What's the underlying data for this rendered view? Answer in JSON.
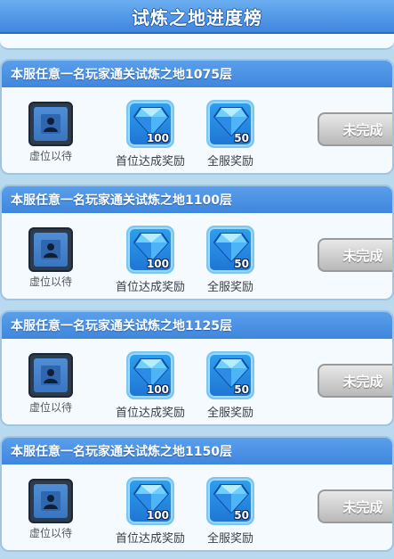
{
  "title": "试炼之地进度榜",
  "colors": {
    "header_blue": "#3f86de",
    "crystal": "#2ea0ee",
    "button_gray": "#b9b9b9"
  },
  "rows": [
    {
      "header": "本服任意一名玩家通关试炼之地1075层",
      "avatar_label": "虚位以待",
      "first_reward": {
        "icon": "diamond-icon",
        "count": "100",
        "label": "首位达成奖励"
      },
      "server_reward": {
        "icon": "diamond-icon",
        "count": "50",
        "label": "全服奖励"
      },
      "status": "未完成"
    },
    {
      "header": "本服任意一名玩家通关试炼之地1100层",
      "avatar_label": "虚位以待",
      "first_reward": {
        "icon": "diamond-icon",
        "count": "100",
        "label": "首位达成奖励"
      },
      "server_reward": {
        "icon": "diamond-icon",
        "count": "50",
        "label": "全服奖励"
      },
      "status": "未完成"
    },
    {
      "header": "本服任意一名玩家通关试炼之地1125层",
      "avatar_label": "虚位以待",
      "first_reward": {
        "icon": "diamond-icon",
        "count": "100",
        "label": "首位达成奖励"
      },
      "server_reward": {
        "icon": "diamond-icon",
        "count": "50",
        "label": "全服奖励"
      },
      "status": "未完成"
    },
    {
      "header": "本服任意一名玩家通关试炼之地1150层",
      "avatar_label": "虚位以待",
      "first_reward": {
        "icon": "diamond-icon",
        "count": "100",
        "label": "首位达成奖励"
      },
      "server_reward": {
        "icon": "diamond-icon",
        "count": "50",
        "label": "全服奖励"
      },
      "status": "未完成"
    }
  ]
}
